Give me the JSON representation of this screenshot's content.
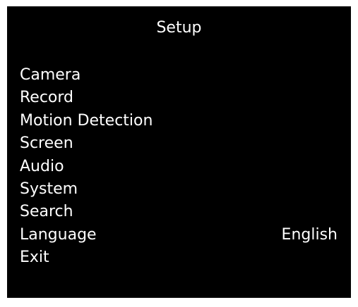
{
  "screen": {
    "title": "Setup",
    "colors": {
      "background": "#000000",
      "text": "#ffffff"
    }
  },
  "menu": {
    "items": [
      {
        "label": "Camera",
        "value": ""
      },
      {
        "label": "Record",
        "value": ""
      },
      {
        "label": "Motion Detection",
        "value": ""
      },
      {
        "label": "Screen",
        "value": ""
      },
      {
        "label": "Audio",
        "value": ""
      },
      {
        "label": "System",
        "value": ""
      },
      {
        "label": "Search",
        "value": ""
      },
      {
        "label": "Language",
        "value": "English"
      },
      {
        "label": "Exit",
        "value": ""
      }
    ]
  }
}
